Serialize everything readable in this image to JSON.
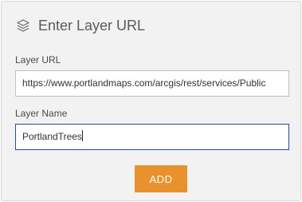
{
  "header": {
    "title": "Enter Layer URL",
    "icon": "layers-icon"
  },
  "form": {
    "url_label": "Layer URL",
    "url_value": "https://www.portlandmaps.com/arcgis/rest/services/Public",
    "name_label": "Layer Name",
    "name_value": "PortlandTrees",
    "add_label": "ADD"
  },
  "colors": {
    "panel_bg": "#f2f2f2",
    "button_bg": "#e8912d",
    "focus_border": "#1f4f99"
  }
}
